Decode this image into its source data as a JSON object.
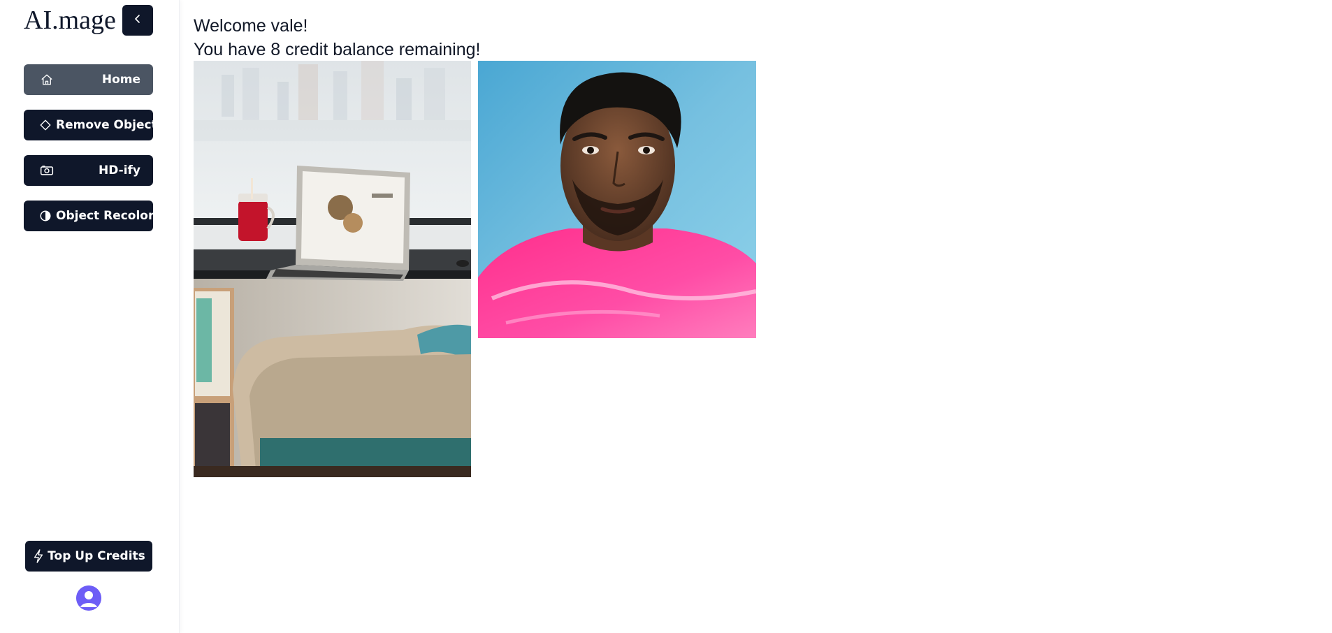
{
  "app": {
    "logo": "AI.mage"
  },
  "sidebar": {
    "collapse_icon": "chevron-left-icon",
    "items": [
      {
        "label": "Home",
        "icon": "home-icon",
        "active": true
      },
      {
        "label": "Remove Object",
        "icon": "eraser-icon",
        "active": false
      },
      {
        "label": "HD-ify",
        "icon": "camera-icon",
        "active": false
      },
      {
        "label": "Object Recolor",
        "icon": "contrast-icon",
        "active": false
      }
    ],
    "topup_label": "Top Up Credits",
    "topup_icon": "lightning-icon",
    "avatar_icon": "user-avatar-icon"
  },
  "main": {
    "welcome": "Welcome vale!",
    "credits": "You have 8 credit balance remaining!",
    "images": [
      {
        "name": "desk-laptop-photo"
      },
      {
        "name": "portrait-photo"
      }
    ]
  },
  "colors": {
    "primary": "#0f172a",
    "active": "#4b5563",
    "avatar": "#6d5df6"
  }
}
